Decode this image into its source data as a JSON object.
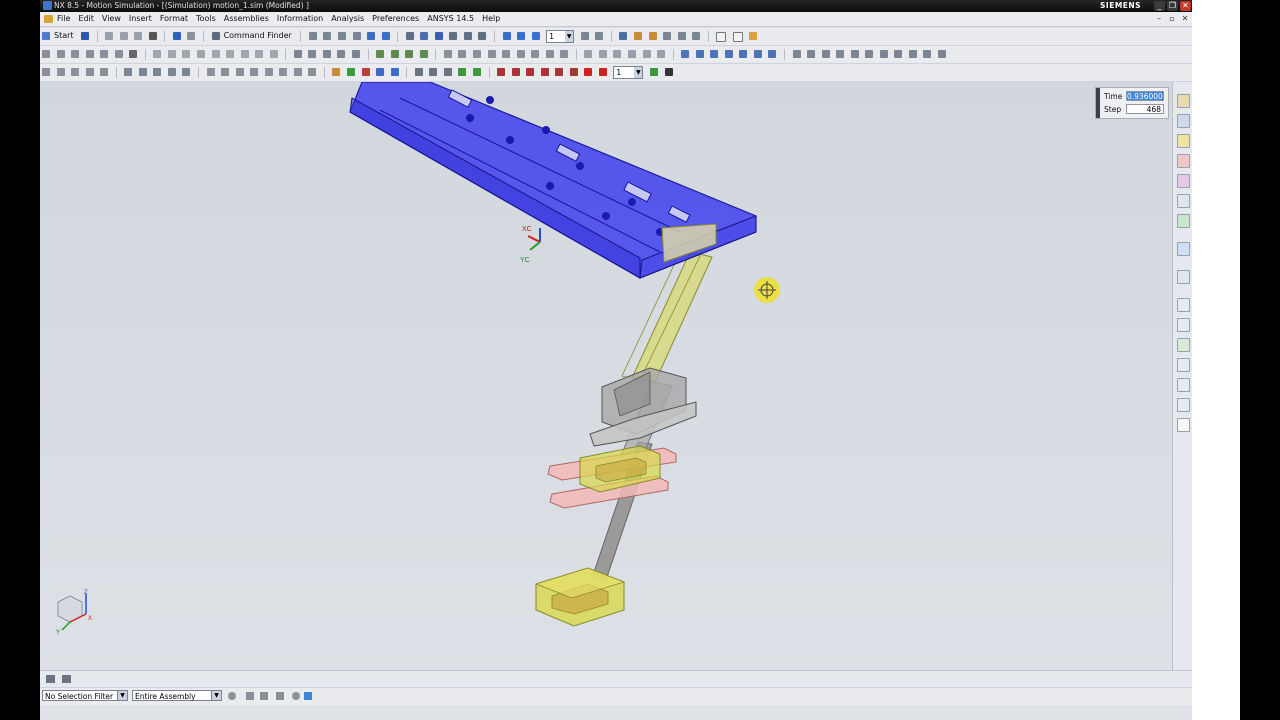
{
  "window": {
    "title": "NX 8.5 - Motion Simulation - [(Simulation) motion_1.sim (Modified) ]",
    "brand": "SIEMENS",
    "controls": {
      "minimize": "_",
      "maximize": "❐",
      "close": "✕"
    }
  },
  "menu": {
    "items": [
      "File",
      "Edit",
      "View",
      "Insert",
      "Format",
      "Tools",
      "Assemblies",
      "Information",
      "Analysis",
      "Preferences",
      "ANSYS 14.5",
      "Help"
    ],
    "mdi_controls": {
      "minimize": "–",
      "restore": "▫",
      "close": "✕"
    }
  },
  "toolbar": {
    "start_label": "Start",
    "command_finder_label": "Command Finder",
    "layer_value": "1",
    "anim_layer_value": "1"
  },
  "animation": {
    "time_label": "Time",
    "time_value": "0.936000",
    "step_label": "Step",
    "step_value": "468"
  },
  "viewport": {
    "triad_labels": {
      "xc": "XC",
      "yc": "YC"
    },
    "view_triad_labels": {
      "x": "X",
      "y": "Y",
      "z": "Z"
    }
  },
  "selection": {
    "filter_value": "No Selection Filter",
    "scope_value": "Entire Assembly"
  },
  "colors": {
    "plate_blue": "#2b2bf0",
    "link_yellow": "#d8d84a",
    "slider_pink": "#f2b8b8",
    "housing_grey": "#a8a8a8",
    "cursor_yellow": "#f0e020",
    "title_bg": "#111111"
  }
}
